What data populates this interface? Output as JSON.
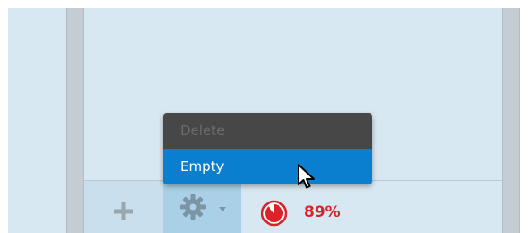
{
  "context_menu": {
    "items": [
      {
        "label": "Delete",
        "enabled": false
      },
      {
        "label": "Empty",
        "enabled": true,
        "highlighted": true
      }
    ]
  },
  "toolbar": {
    "add_button_icon": "plus-icon",
    "settings_button_icon": "gear-icon",
    "settings_dropdown_icon": "caret-down-icon",
    "quota_icon": "pie-chart-icon",
    "quota_percent": 89,
    "quota_label": "89%"
  },
  "colors": {
    "panel_background": "#d8e8f2",
    "divider": "#c5cdd4",
    "menu_background": "#474747",
    "menu_highlight": "#0a7fd0",
    "menu_disabled_text": "#6b6b6b",
    "quota_red": "#d8232a",
    "settings_button_bg": "#a9d0e6",
    "add_button_bg": "#c9dfee"
  }
}
